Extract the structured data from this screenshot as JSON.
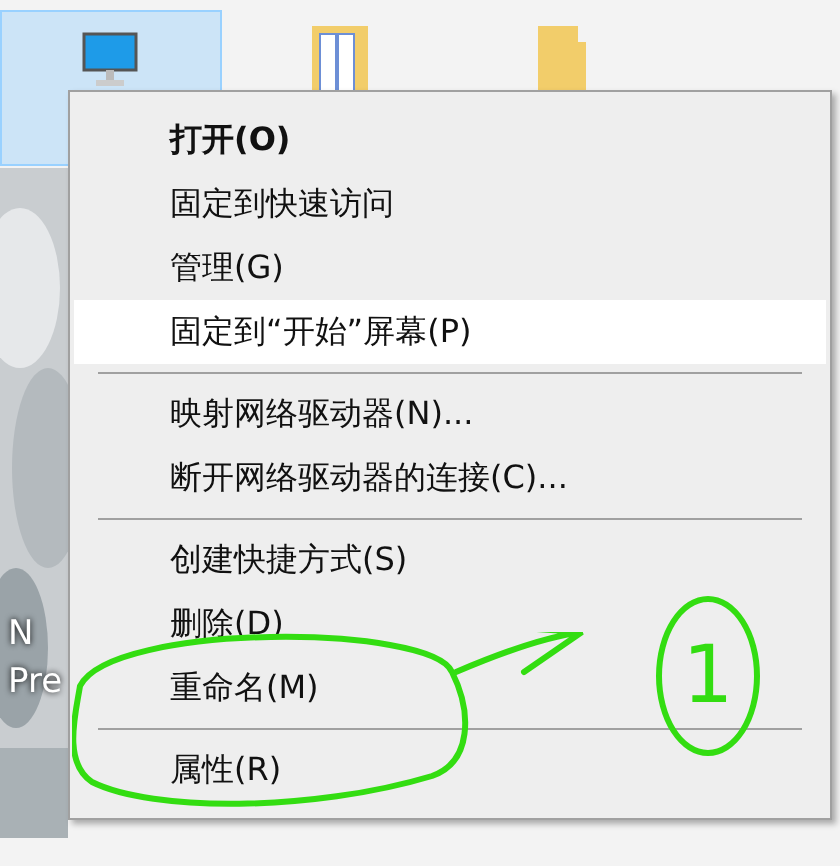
{
  "desktop": {
    "icons": [
      {
        "kind": "computer",
        "selected": true
      },
      {
        "kind": "documents-folder",
        "selected": false
      },
      {
        "kind": "folder",
        "selected": false
      }
    ],
    "labels": [
      "N",
      "Pre"
    ]
  },
  "context_menu": {
    "items": [
      {
        "kind": "item",
        "label": "打开(O)",
        "bold": true,
        "selected": false
      },
      {
        "kind": "item",
        "label": "固定到快速访问",
        "bold": false,
        "selected": false
      },
      {
        "kind": "item",
        "label": "管理(G)",
        "bold": false,
        "selected": false
      },
      {
        "kind": "item",
        "label": "固定到“开始”屏幕(P)",
        "bold": false,
        "selected": true
      },
      {
        "kind": "separator"
      },
      {
        "kind": "item",
        "label": "映射网络驱动器(N)...",
        "bold": false,
        "selected": false
      },
      {
        "kind": "item",
        "label": "断开网络驱动器的连接(C)...",
        "bold": false,
        "selected": false
      },
      {
        "kind": "separator"
      },
      {
        "kind": "item",
        "label": "创建快捷方式(S)",
        "bold": false,
        "selected": false
      },
      {
        "kind": "item",
        "label": "删除(D)",
        "bold": false,
        "selected": false
      },
      {
        "kind": "item",
        "label": "重命名(M)",
        "bold": false,
        "selected": false
      },
      {
        "kind": "separator"
      },
      {
        "kind": "item",
        "label": "属性(R)",
        "bold": false,
        "selected": false
      }
    ]
  },
  "annotation": {
    "label": "1"
  }
}
